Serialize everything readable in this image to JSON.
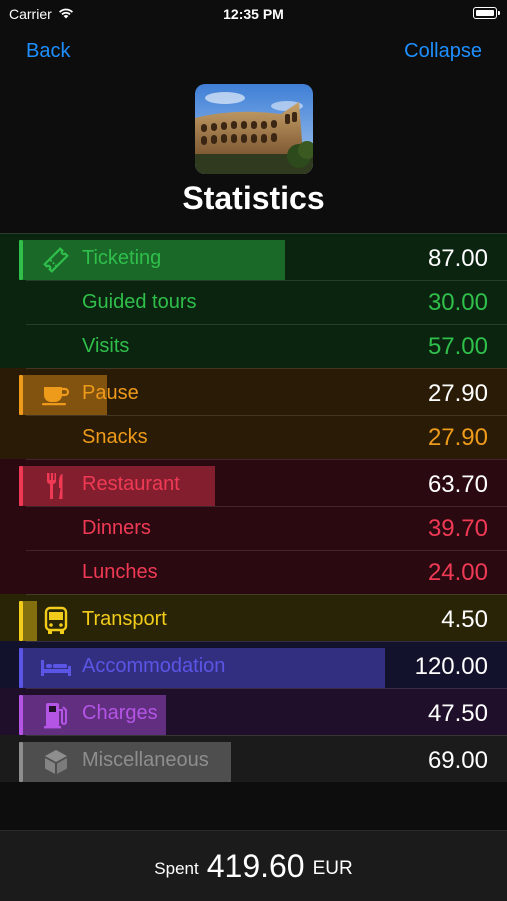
{
  "status_bar": {
    "carrier": "Carrier",
    "time": "12:35 PM"
  },
  "nav": {
    "back_label": "Back",
    "collapse_label": "Collapse"
  },
  "header": {
    "title": "Statistics"
  },
  "rows": [
    {
      "kind": "category",
      "label": "Ticketing",
      "amount": "87.00",
      "icon": "ticket-icon",
      "color": "#2fbf4a",
      "bg": "#0a2410",
      "bar_fraction": 0.725
    },
    {
      "kind": "sub",
      "label": "Guided tours",
      "amount": "30.00",
      "color": "#2fbf4a",
      "bg": "#0a2410"
    },
    {
      "kind": "sub",
      "label": "Visits",
      "amount": "57.00",
      "color": "#2fbf4a",
      "bg": "#0a2410"
    },
    {
      "kind": "category",
      "label": "Pause",
      "amount": "27.90",
      "icon": "coffee-cup-icon",
      "color": "#ee9a1a",
      "bg": "#2a1b06",
      "bar_fraction": 0.2325
    },
    {
      "kind": "sub",
      "label": "Snacks",
      "amount": "27.90",
      "color": "#ee9a1a",
      "bg": "#2a1b06"
    },
    {
      "kind": "category",
      "label": "Restaurant",
      "amount": "63.70",
      "icon": "fork-knife-icon",
      "color": "#f03a55",
      "bg": "#2a0910",
      "bar_fraction": 0.531
    },
    {
      "kind": "sub",
      "label": "Dinners",
      "amount": "39.70",
      "color": "#f03a55",
      "bg": "#2a0910"
    },
    {
      "kind": "sub",
      "label": "Lunches",
      "amount": "24.00",
      "color": "#f03a55",
      "bg": "#2a0910"
    },
    {
      "kind": "category",
      "label": "Transport",
      "amount": "4.50",
      "icon": "bus-icon",
      "color": "#f2cc1a",
      "bg": "#2a2406",
      "bar_fraction": 0.0375
    },
    {
      "kind": "category",
      "label": "Accommodation",
      "amount": "120.00",
      "icon": "bed-icon",
      "color": "#5b55e6",
      "bg": "#13122c",
      "bar_fraction": 1.0
    },
    {
      "kind": "category",
      "label": "Charges",
      "amount": "47.50",
      "icon": "fuel-pump-icon",
      "color": "#b455e6",
      "bg": "#200f2a",
      "bar_fraction": 0.396
    },
    {
      "kind": "category",
      "label": "Miscellaneous",
      "amount": "69.00",
      "icon": "cube-icon",
      "color": "#8e8e8e",
      "bg": "#1b1b1b",
      "bar_fraction": 0.575
    }
  ],
  "footer": {
    "spent_label": "Spent",
    "spent_value": "419.60",
    "currency": "EUR"
  }
}
